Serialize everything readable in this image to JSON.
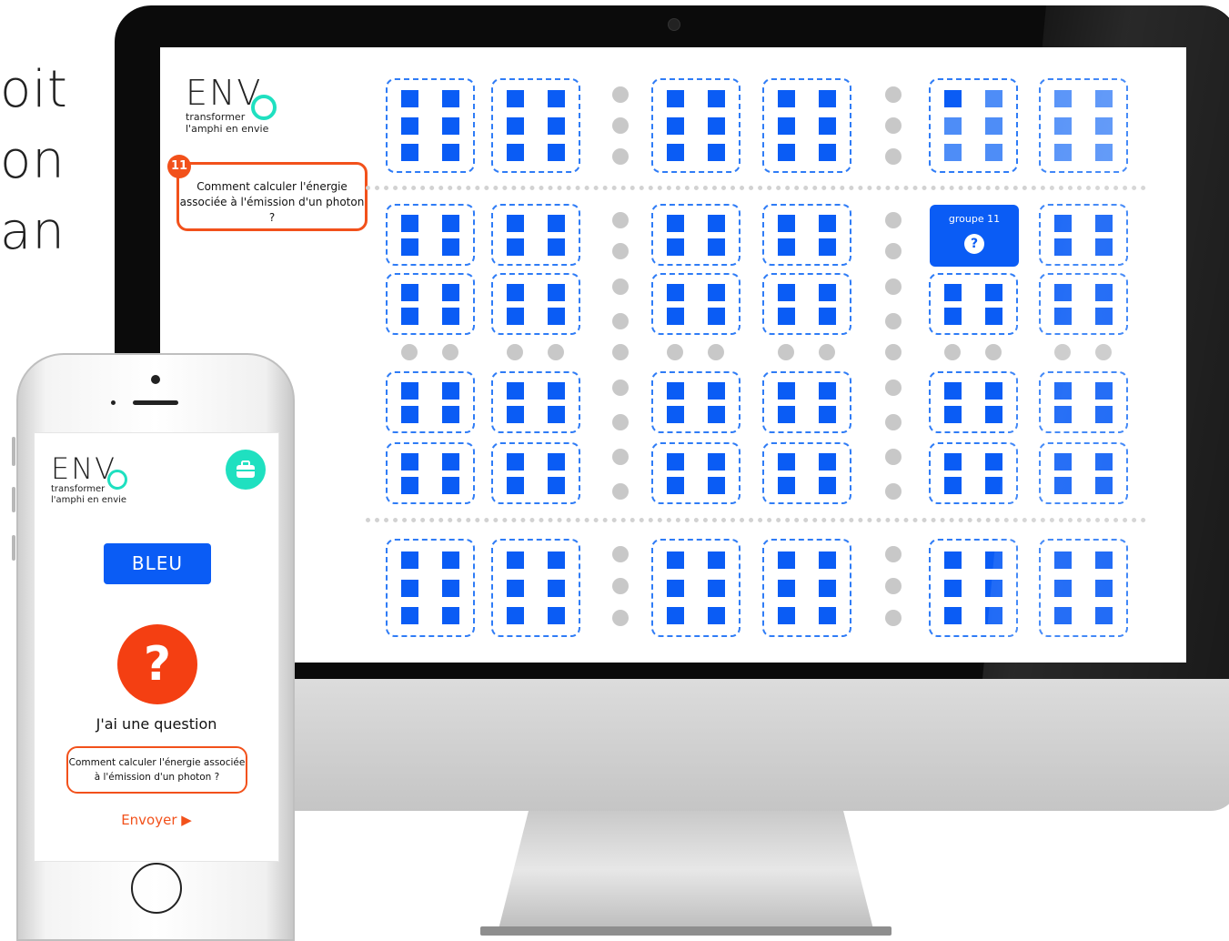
{
  "background_text": [
    "oit",
    "on",
    "an"
  ],
  "desktop": {
    "logo": {
      "mark": "ENV",
      "line1": "transformer",
      "line2": "l'amphi en envie"
    },
    "question_bubble": {
      "number": "11",
      "text": "Comment calculer l'énergie associée à l'émission d'un photon ?"
    },
    "group_card": {
      "label": "groupe 11",
      "icon": "?"
    }
  },
  "phone": {
    "logo": {
      "mark": "ENV",
      "line1": "transformer",
      "line2": "l'amphi en envie"
    },
    "briefcase_icon": "briefcase-icon",
    "team_button": "BLEU",
    "question_icon": "?",
    "question_heading": "J'ai une question",
    "question_text": "Comment calculer l'énergie associée à l'émission d'un photon ?",
    "send_label": "Envoyer ▶"
  },
  "colors": {
    "accent_blue": "#0a5cf5",
    "accent_orange": "#f2511b",
    "accent_teal": "#1fe0c0"
  }
}
